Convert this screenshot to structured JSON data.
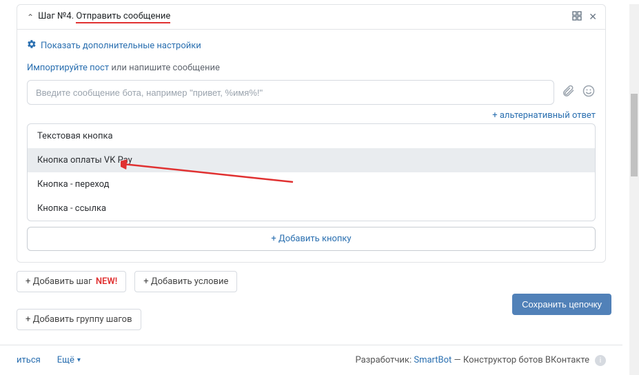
{
  "header": {
    "title_prefix": "Шаг №4.",
    "title_action": "Отправить сообщение"
  },
  "settings_link": "Показать дополнительные настройки",
  "import": {
    "link": "Импортируйте пост",
    "rest": " или напишите сообщение"
  },
  "message": {
    "placeholder": "Введите сообщение бота, например \"привет, %имя%!\""
  },
  "alt_answer": "+ альтернативный ответ",
  "button_types": {
    "items": [
      {
        "label": "Текстовая кнопка"
      },
      {
        "label": "Кнопка оплаты VK Pay"
      },
      {
        "label": "Кнопка - переход"
      },
      {
        "label": "Кнопка - ссылка"
      }
    ]
  },
  "add_button": "+ Добавить кнопку",
  "actions": {
    "add_step_prefix": "+ Добавить шаг",
    "add_step_badge": "NEW!",
    "add_condition": "+ Добавить условие",
    "add_group": "+ Добавить группу шагов",
    "save_chain": "Сохранить цепочку"
  },
  "footer": {
    "share_suffix": "иться",
    "more": "Ещё",
    "dev_label": "Разработчик:",
    "dev_name": "SmartBot",
    "dev_desc": "— Конструктор ботов ВКонтакте"
  }
}
